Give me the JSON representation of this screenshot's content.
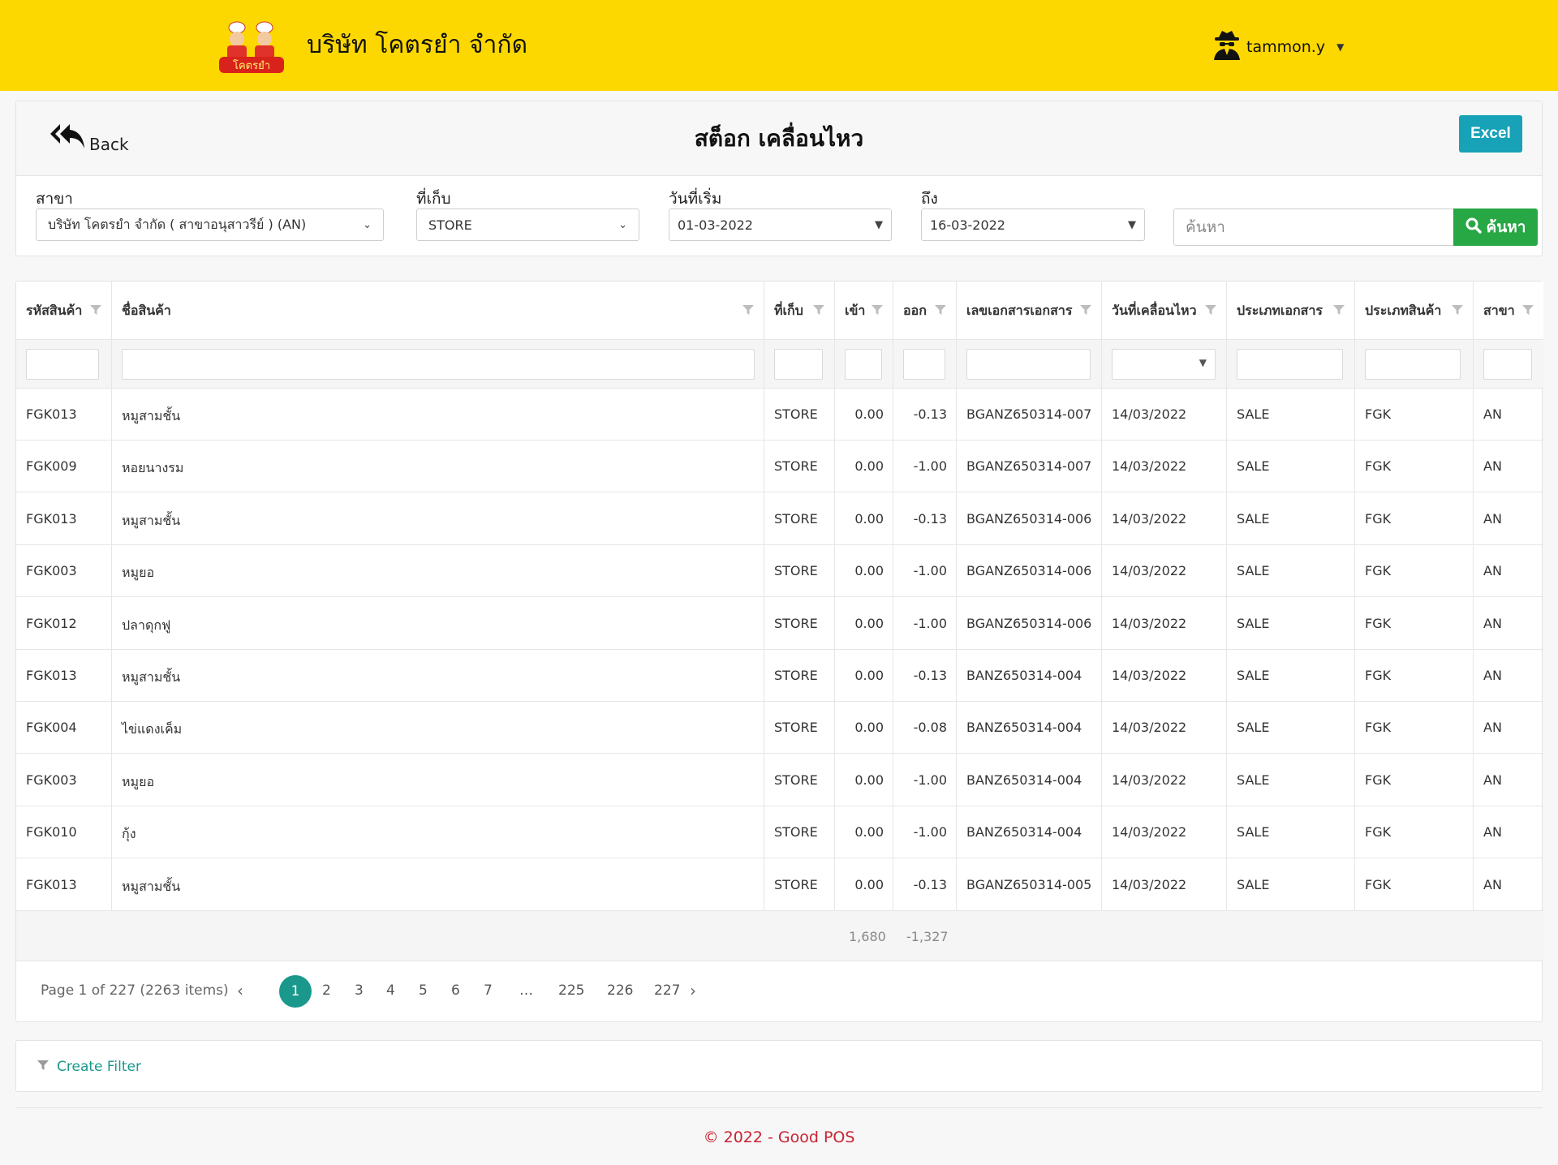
{
  "header": {
    "company": "บริษัท โคตรยำ จำกัด",
    "logo_text": "โคตรยำ",
    "username": "tammon.y"
  },
  "page": {
    "back_label": "Back",
    "title": "สต็อก เคลื่อนไหว",
    "excel_label": "Excel"
  },
  "filters": {
    "branch_label": "สาขา",
    "branch_value": "บริษัท โคตรยำ จำกัด ( สาขาอนุสาวรีย์ ) (AN)",
    "storage_label": "ที่เก็บ",
    "storage_value": "STORE",
    "start_label": "วันที่เริ่ม",
    "start_value": "01-03-2022",
    "end_label": "ถึง",
    "end_value": "16-03-2022",
    "search_placeholder": "ค้นหา",
    "search_button": "ค้นหา"
  },
  "table": {
    "columns": [
      "รหัสสินค้า",
      "ชื่อสินค้า",
      "ที่เก็บ",
      "เข้า",
      "ออก",
      "เลขเอกสารเอกสาร",
      "วันที่เคลื่อนไหว",
      "ประเภทเอกสาร",
      "ประเภทสินค้า",
      "สาขา"
    ],
    "rows": [
      [
        "FGK013",
        "หมูสามชั้น",
        "STORE",
        "0.00",
        "-0.13",
        "BGANZ650314-007",
        "14/03/2022",
        "SALE",
        "FGK",
        "AN"
      ],
      [
        "FGK009",
        "หอยนางรม",
        "STORE",
        "0.00",
        "-1.00",
        "BGANZ650314-007",
        "14/03/2022",
        "SALE",
        "FGK",
        "AN"
      ],
      [
        "FGK013",
        "หมูสามชั้น",
        "STORE",
        "0.00",
        "-0.13",
        "BGANZ650314-006",
        "14/03/2022",
        "SALE",
        "FGK",
        "AN"
      ],
      [
        "FGK003",
        "หมูยอ",
        "STORE",
        "0.00",
        "-1.00",
        "BGANZ650314-006",
        "14/03/2022",
        "SALE",
        "FGK",
        "AN"
      ],
      [
        "FGK012",
        "ปลาดุกฟู",
        "STORE",
        "0.00",
        "-1.00",
        "BGANZ650314-006",
        "14/03/2022",
        "SALE",
        "FGK",
        "AN"
      ],
      [
        "FGK013",
        "หมูสามชั้น",
        "STORE",
        "0.00",
        "-0.13",
        "BANZ650314-004",
        "14/03/2022",
        "SALE",
        "FGK",
        "AN"
      ],
      [
        "FGK004",
        "ไข่แดงเค็ม",
        "STORE",
        "0.00",
        "-0.08",
        "BANZ650314-004",
        "14/03/2022",
        "SALE",
        "FGK",
        "AN"
      ],
      [
        "FGK003",
        "หมูยอ",
        "STORE",
        "0.00",
        "-1.00",
        "BANZ650314-004",
        "14/03/2022",
        "SALE",
        "FGK",
        "AN"
      ],
      [
        "FGK010",
        "กุ้ง",
        "STORE",
        "0.00",
        "-1.00",
        "BANZ650314-004",
        "14/03/2022",
        "SALE",
        "FGK",
        "AN"
      ],
      [
        "FGK013",
        "หมูสามชั้น",
        "STORE",
        "0.00",
        "-0.13",
        "BGANZ650314-005",
        "14/03/2022",
        "SALE",
        "FGK",
        "AN"
      ]
    ],
    "total_in": "1,680",
    "total_out": "-1,327"
  },
  "pager": {
    "info": "Page 1 of 227 (2263 items)",
    "pages": [
      "1",
      "2",
      "3",
      "4",
      "5",
      "6",
      "7",
      "…",
      "225",
      "226",
      "227"
    ],
    "active": "1"
  },
  "filter_bar": {
    "create_filter": "Create Filter"
  },
  "footer": {
    "text": "© 2022 - Good POS"
  },
  "colors": {
    "header_bg": "#fdd800",
    "excel": "#17a2b8",
    "search": "#28a745",
    "accent": "#19988b",
    "footer_text": "#c82333"
  }
}
